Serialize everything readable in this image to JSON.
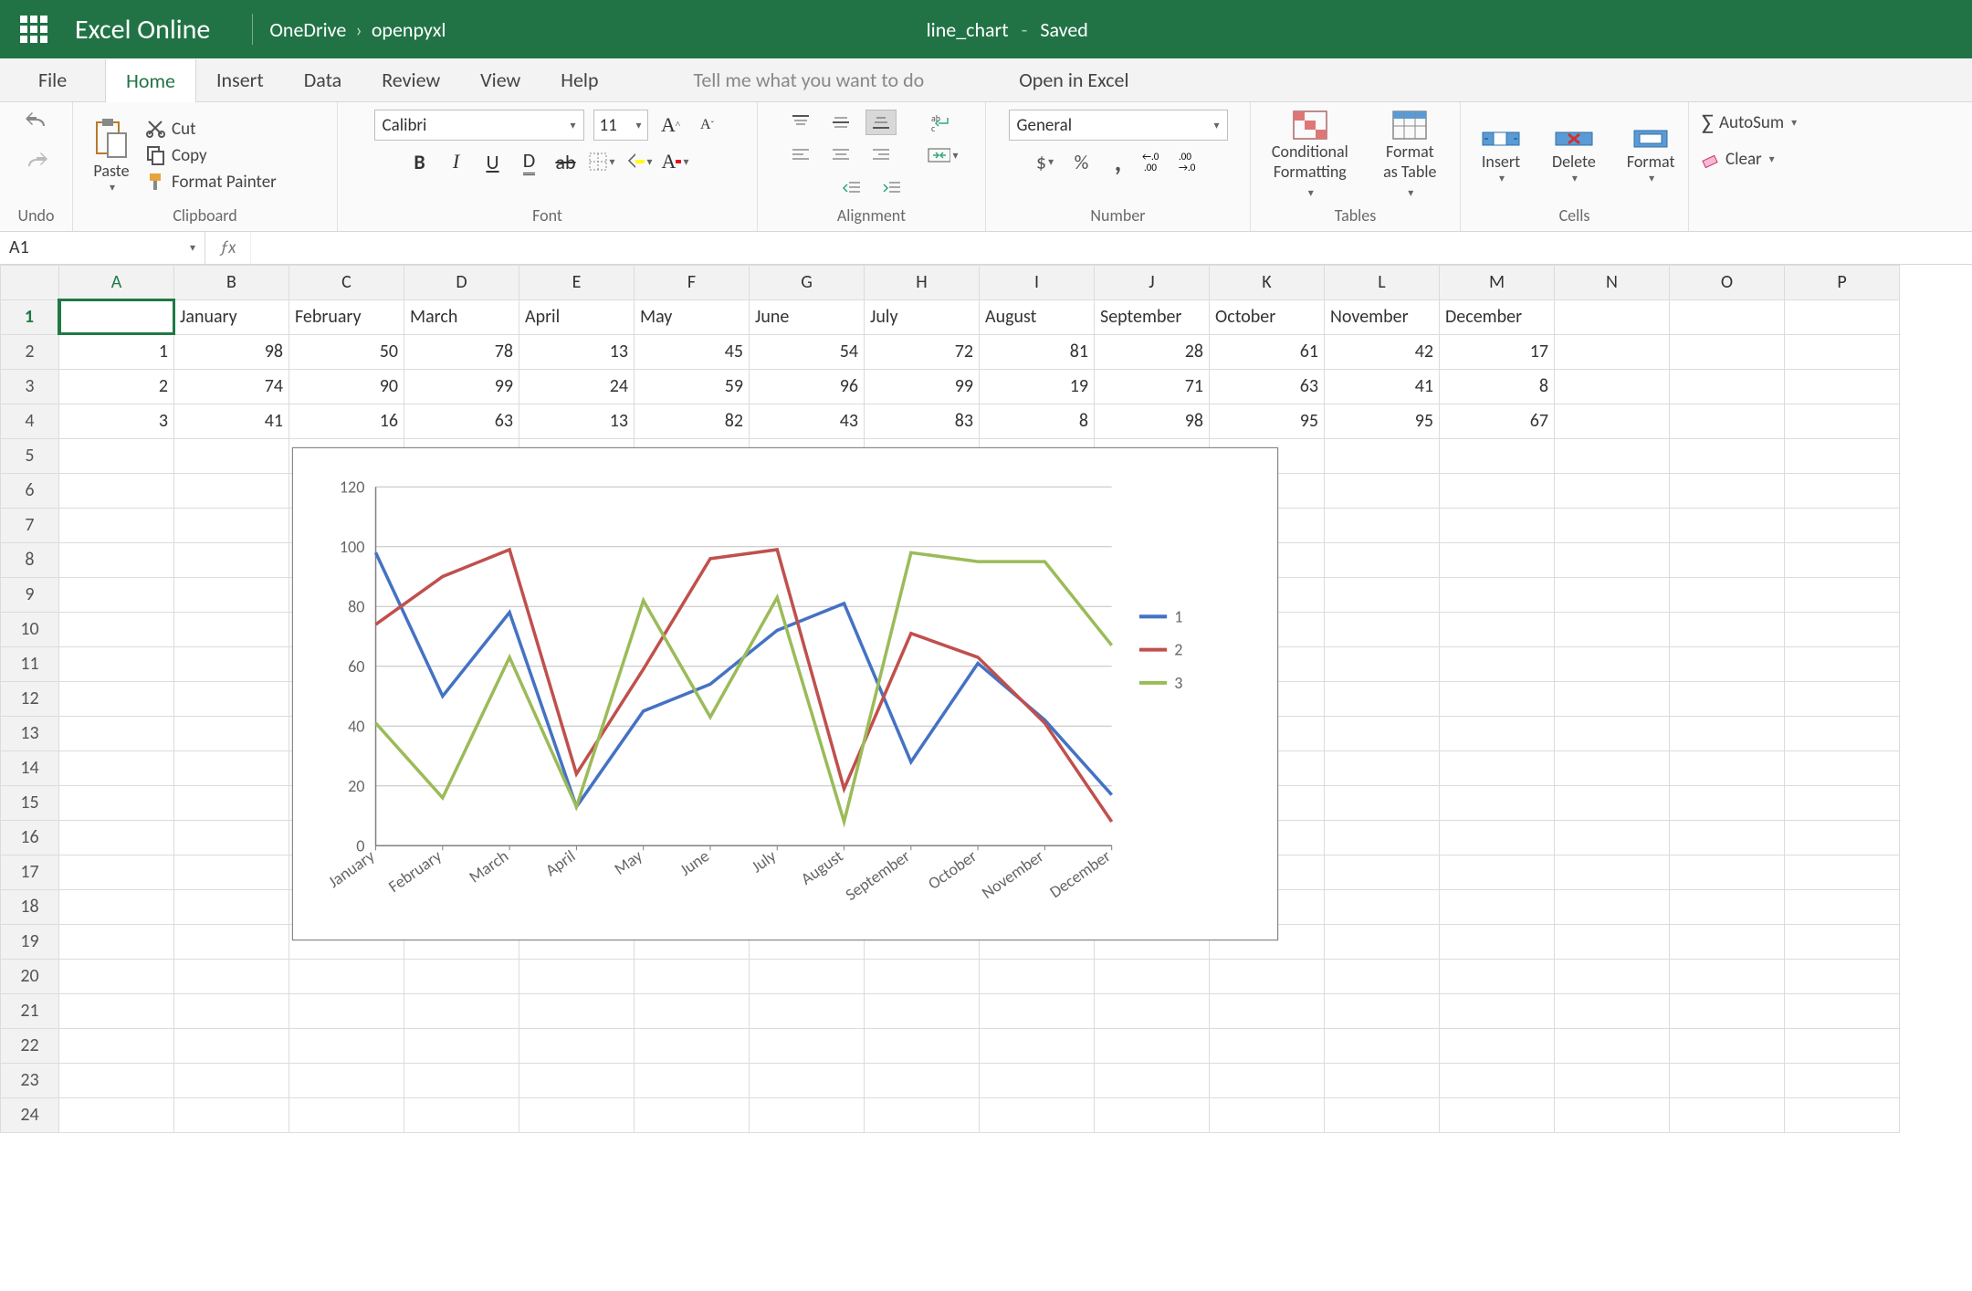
{
  "titlebar": {
    "app_name": "Excel Online",
    "crumb1": "OneDrive",
    "crumb2": "openpyxl",
    "filename": "line_chart",
    "save_status": "Saved"
  },
  "tabs": {
    "file": "File",
    "home": "Home",
    "insert": "Insert",
    "data": "Data",
    "review": "Review",
    "view": "View",
    "help": "Help",
    "tell_me": "Tell me what you want to do",
    "open_excel": "Open in Excel"
  },
  "ribbon": {
    "undo_group": "Undo",
    "clipboard_group": "Clipboard",
    "font_group": "Font",
    "alignment_group": "Alignment",
    "number_group": "Number",
    "tables_group": "Tables",
    "cells_group": "Cells",
    "paste": "Paste",
    "cut": "Cut",
    "copy": "Copy",
    "format_painter": "Format Painter",
    "font_name": "Calibri",
    "font_size": "11",
    "number_format": "General",
    "cond_fmt1": "Conditional",
    "cond_fmt2": "Formatting",
    "fmt_table1": "Format",
    "fmt_table2": "as Table",
    "insert": "Insert",
    "delete": "Delete",
    "format": "Format",
    "autosum": "AutoSum",
    "clear": "Clear"
  },
  "namebox": "A1",
  "columns": [
    "A",
    "B",
    "C",
    "D",
    "E",
    "F",
    "G",
    "H",
    "I",
    "J",
    "K",
    "L",
    "M",
    "N",
    "O",
    "P"
  ],
  "row_numbers": [
    1,
    2,
    3,
    4,
    5,
    6,
    7,
    8,
    9,
    10,
    11,
    12,
    13,
    14,
    15,
    16,
    17,
    18,
    19,
    20,
    21,
    22,
    23,
    24
  ],
  "sheet": {
    "r1": [
      "",
      "January",
      "February",
      "March",
      "April",
      "May",
      "June",
      "July",
      "August",
      "September",
      "October",
      "November",
      "December",
      "",
      "",
      ""
    ],
    "r2": [
      "1",
      "98",
      "50",
      "78",
      "13",
      "45",
      "54",
      "72",
      "81",
      "28",
      "61",
      "42",
      "17",
      "",
      "",
      ""
    ],
    "r3": [
      "2",
      "74",
      "90",
      "99",
      "24",
      "59",
      "96",
      "99",
      "19",
      "71",
      "63",
      "41",
      "8",
      "",
      "",
      ""
    ],
    "r4": [
      "3",
      "41",
      "16",
      "63",
      "13",
      "82",
      "43",
      "83",
      "8",
      "98",
      "95",
      "95",
      "67",
      "",
      "",
      ""
    ]
  },
  "chart_data": {
    "type": "line",
    "categories": [
      "January",
      "February",
      "March",
      "April",
      "May",
      "June",
      "July",
      "August",
      "September",
      "October",
      "November",
      "December"
    ],
    "series": [
      {
        "name": "1",
        "color": "#4472C4",
        "values": [
          98,
          50,
          78,
          13,
          45,
          54,
          72,
          81,
          28,
          61,
          42,
          17
        ]
      },
      {
        "name": "2",
        "color": "#C0504D",
        "values": [
          74,
          90,
          99,
          24,
          59,
          96,
          99,
          19,
          71,
          63,
          41,
          8
        ]
      },
      {
        "name": "3",
        "color": "#9BBB59",
        "values": [
          41,
          16,
          63,
          13,
          82,
          43,
          83,
          8,
          98,
          95,
          95,
          67
        ]
      }
    ],
    "ylim": [
      0,
      120
    ],
    "yticks": [
      0,
      20,
      40,
      60,
      80,
      100,
      120
    ],
    "title": "",
    "xlabel": "",
    "ylabel": ""
  }
}
